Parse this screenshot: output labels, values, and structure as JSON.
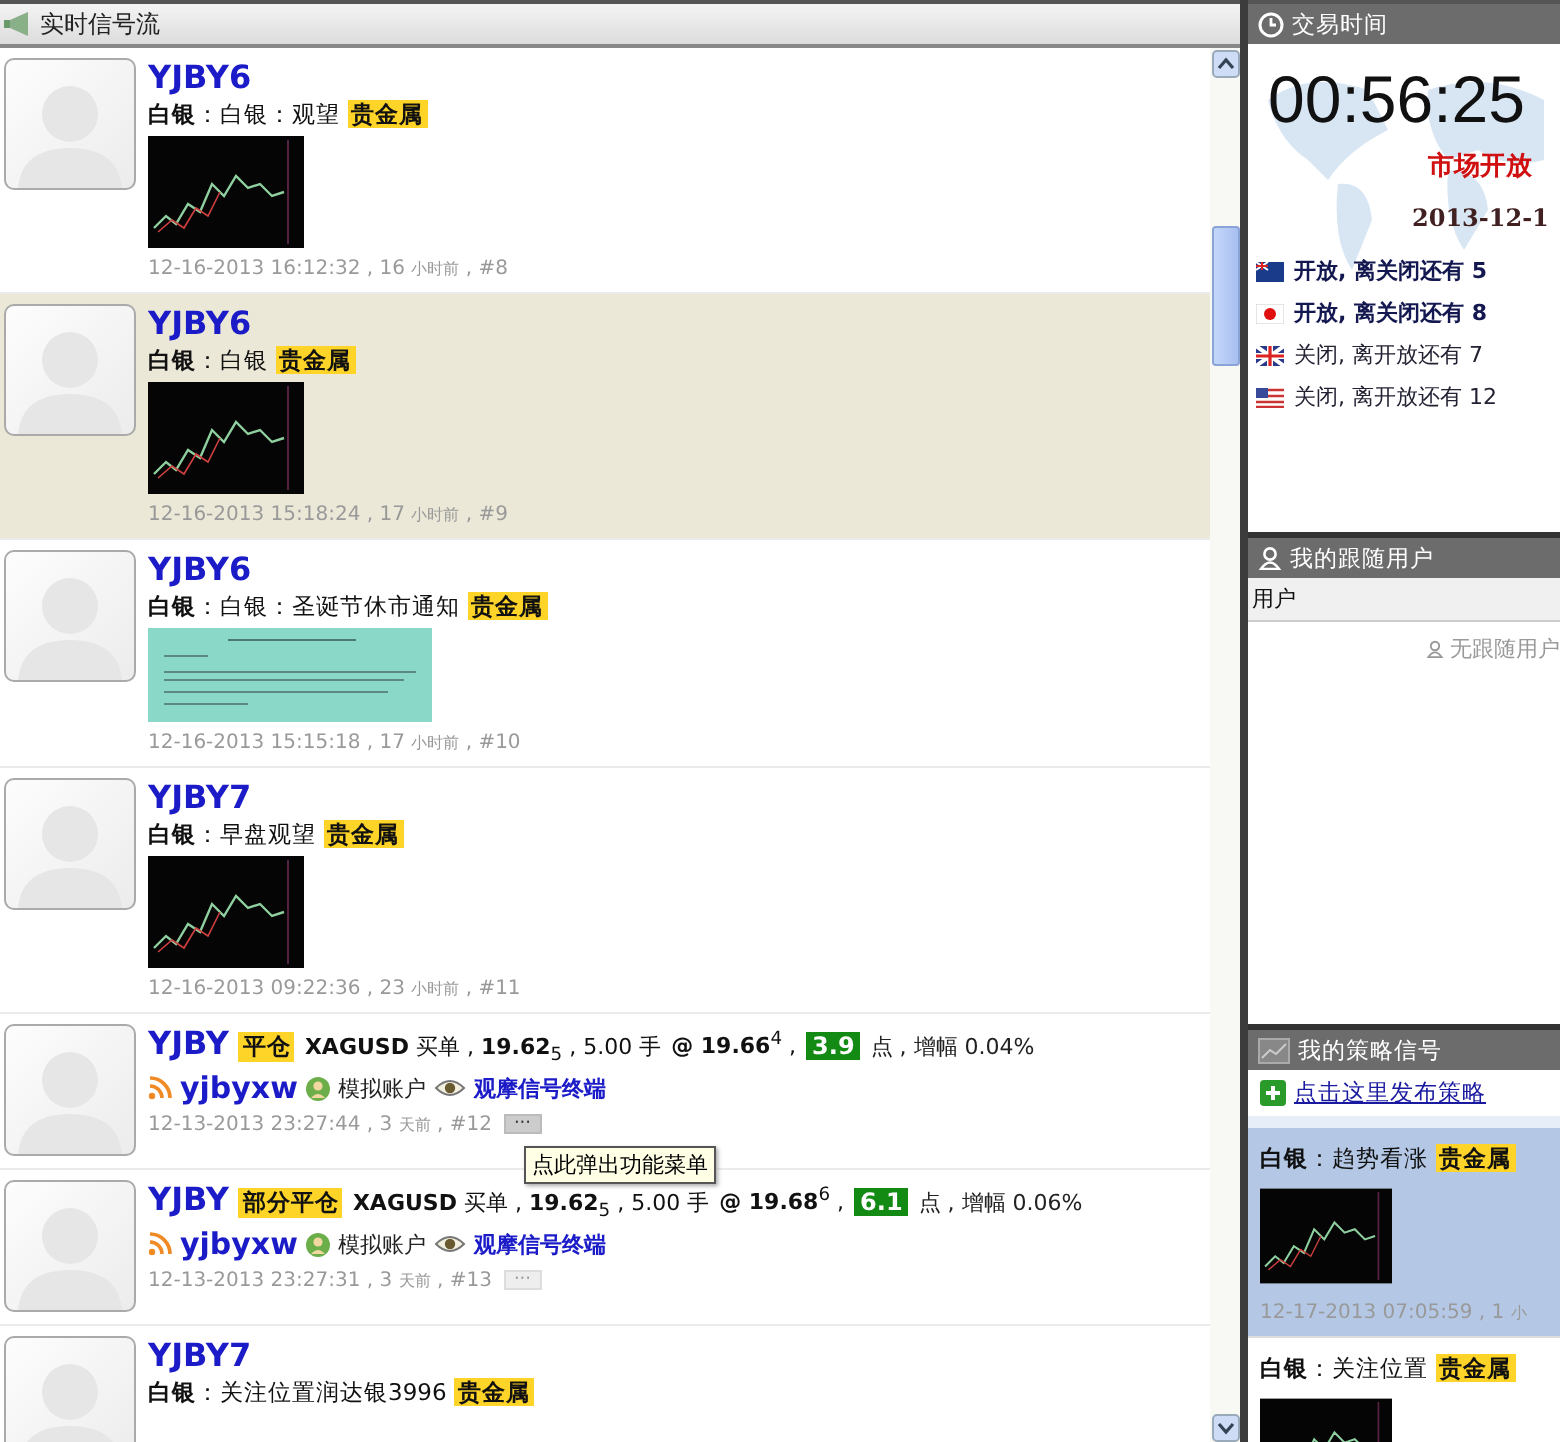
{
  "feed": {
    "title": "实时信号流",
    "items": [
      {
        "kind": "note",
        "selected": false,
        "author": "YJBY6",
        "subject": "白银",
        "body": "：白银：观望",
        "tag": "贵金属",
        "picture": {
          "kind": "chart"
        },
        "meta": "12-16-2013 16:12:32 , 16",
        "unit": "小时前",
        "index": ", #8"
      },
      {
        "kind": "note",
        "selected": true,
        "author": "YJBY6",
        "subject": "白银",
        "body": "：白银",
        "tag": "贵金属",
        "picture": {
          "kind": "chart"
        },
        "meta": "12-16-2013 15:18:24 , 17",
        "unit": "小时前",
        "index": ", #9"
      },
      {
        "kind": "note",
        "selected": false,
        "author": "YJBY6",
        "subject": "白银",
        "body": "：白银：圣诞节休市通知",
        "tag": "贵金属",
        "picture": {
          "kind": "document"
        },
        "meta": "12-16-2013 15:15:18 , 17",
        "unit": "小时前",
        "index": ", #10"
      },
      {
        "kind": "note",
        "selected": false,
        "author": "YJBY7",
        "subject": "白银",
        "body": "：早盘观望",
        "tag": "贵金属",
        "picture": {
          "kind": "chart"
        },
        "meta": "12-16-2013 09:22:36 , 23",
        "unit": "小时前",
        "index": ", #11"
      },
      {
        "kind": "trade",
        "selected": false,
        "author": "YJBY",
        "action": "平仓",
        "order": "**XAGUSD** 买单 , **19.62**$_{5}$ , 5.00 手",
        "fill": "**@ 19.66**$^{4}$ ,",
        "pips": "3.9",
        "change": "点 , 增幅 0.04%",
        "source": "yjbyxw",
        "account": "模拟账户",
        "link": "观摩信号终端",
        "meta": "12-13-2013 23:27:44 , 3",
        "unit": "天前",
        "index": ", #12",
        "more": "···",
        "hovered": true,
        "tooltip": "点此弹出功能菜单"
      },
      {
        "kind": "trade",
        "selected": false,
        "author": "YJBY",
        "action": "部分平仓",
        "order": "**XAGUSD** 买单 , **19.62**$_{5}$ , 5.00 手",
        "fill": "**@ 19.68**$^{6}$ ,",
        "pips": "6.1",
        "change": "点 , 增幅 0.06%",
        "source": "yjbyxw",
        "account": "模拟账户",
        "link": "观摩信号终端",
        "meta": "12-13-2013 23:27:31 , 3",
        "unit": "天前",
        "index": ", #13",
        "more": "···",
        "hovered": false
      },
      {
        "kind": "note",
        "selected": false,
        "author": "YJBY7",
        "subject": "白银",
        "body": "：关注位置润达银3996",
        "tag": "贵金属"
      }
    ]
  },
  "market": {
    "title": "交易时间",
    "clock": "00:56:25",
    "status": "市场开放",
    "date": "2013-12-1",
    "sessions": [
      {
        "kind": "au",
        "open": true,
        "text": "开放, 离关闭还有 5"
      },
      {
        "kind": "jp",
        "open": true,
        "text": "开放, 离关闭还有 8"
      },
      {
        "kind": "uk",
        "open": false,
        "text": "关闭, 离开放还有 7"
      },
      {
        "kind": "us",
        "open": false,
        "text": "关闭, 离开放还有 12"
      }
    ]
  },
  "followers": {
    "title": "我的跟随用户",
    "column": "用户",
    "empty": "无跟随用户"
  },
  "strategies": {
    "title": "我的策略信号",
    "publish": "点击这里发布策略",
    "items": [
      {
        "selected": true,
        "subject": "白银",
        "body": "：趋势看涨",
        "tag": "贵金属",
        "picture": {
          "kind": "chart"
        },
        "meta": "12-17-2013 07:05:59 , 1",
        "unit": "小"
      },
      {
        "selected": false,
        "subject": "白银",
        "body": "：关注位置",
        "tag": "贵金属",
        "picture": {
          "kind": "chart"
        }
      }
    ]
  }
}
